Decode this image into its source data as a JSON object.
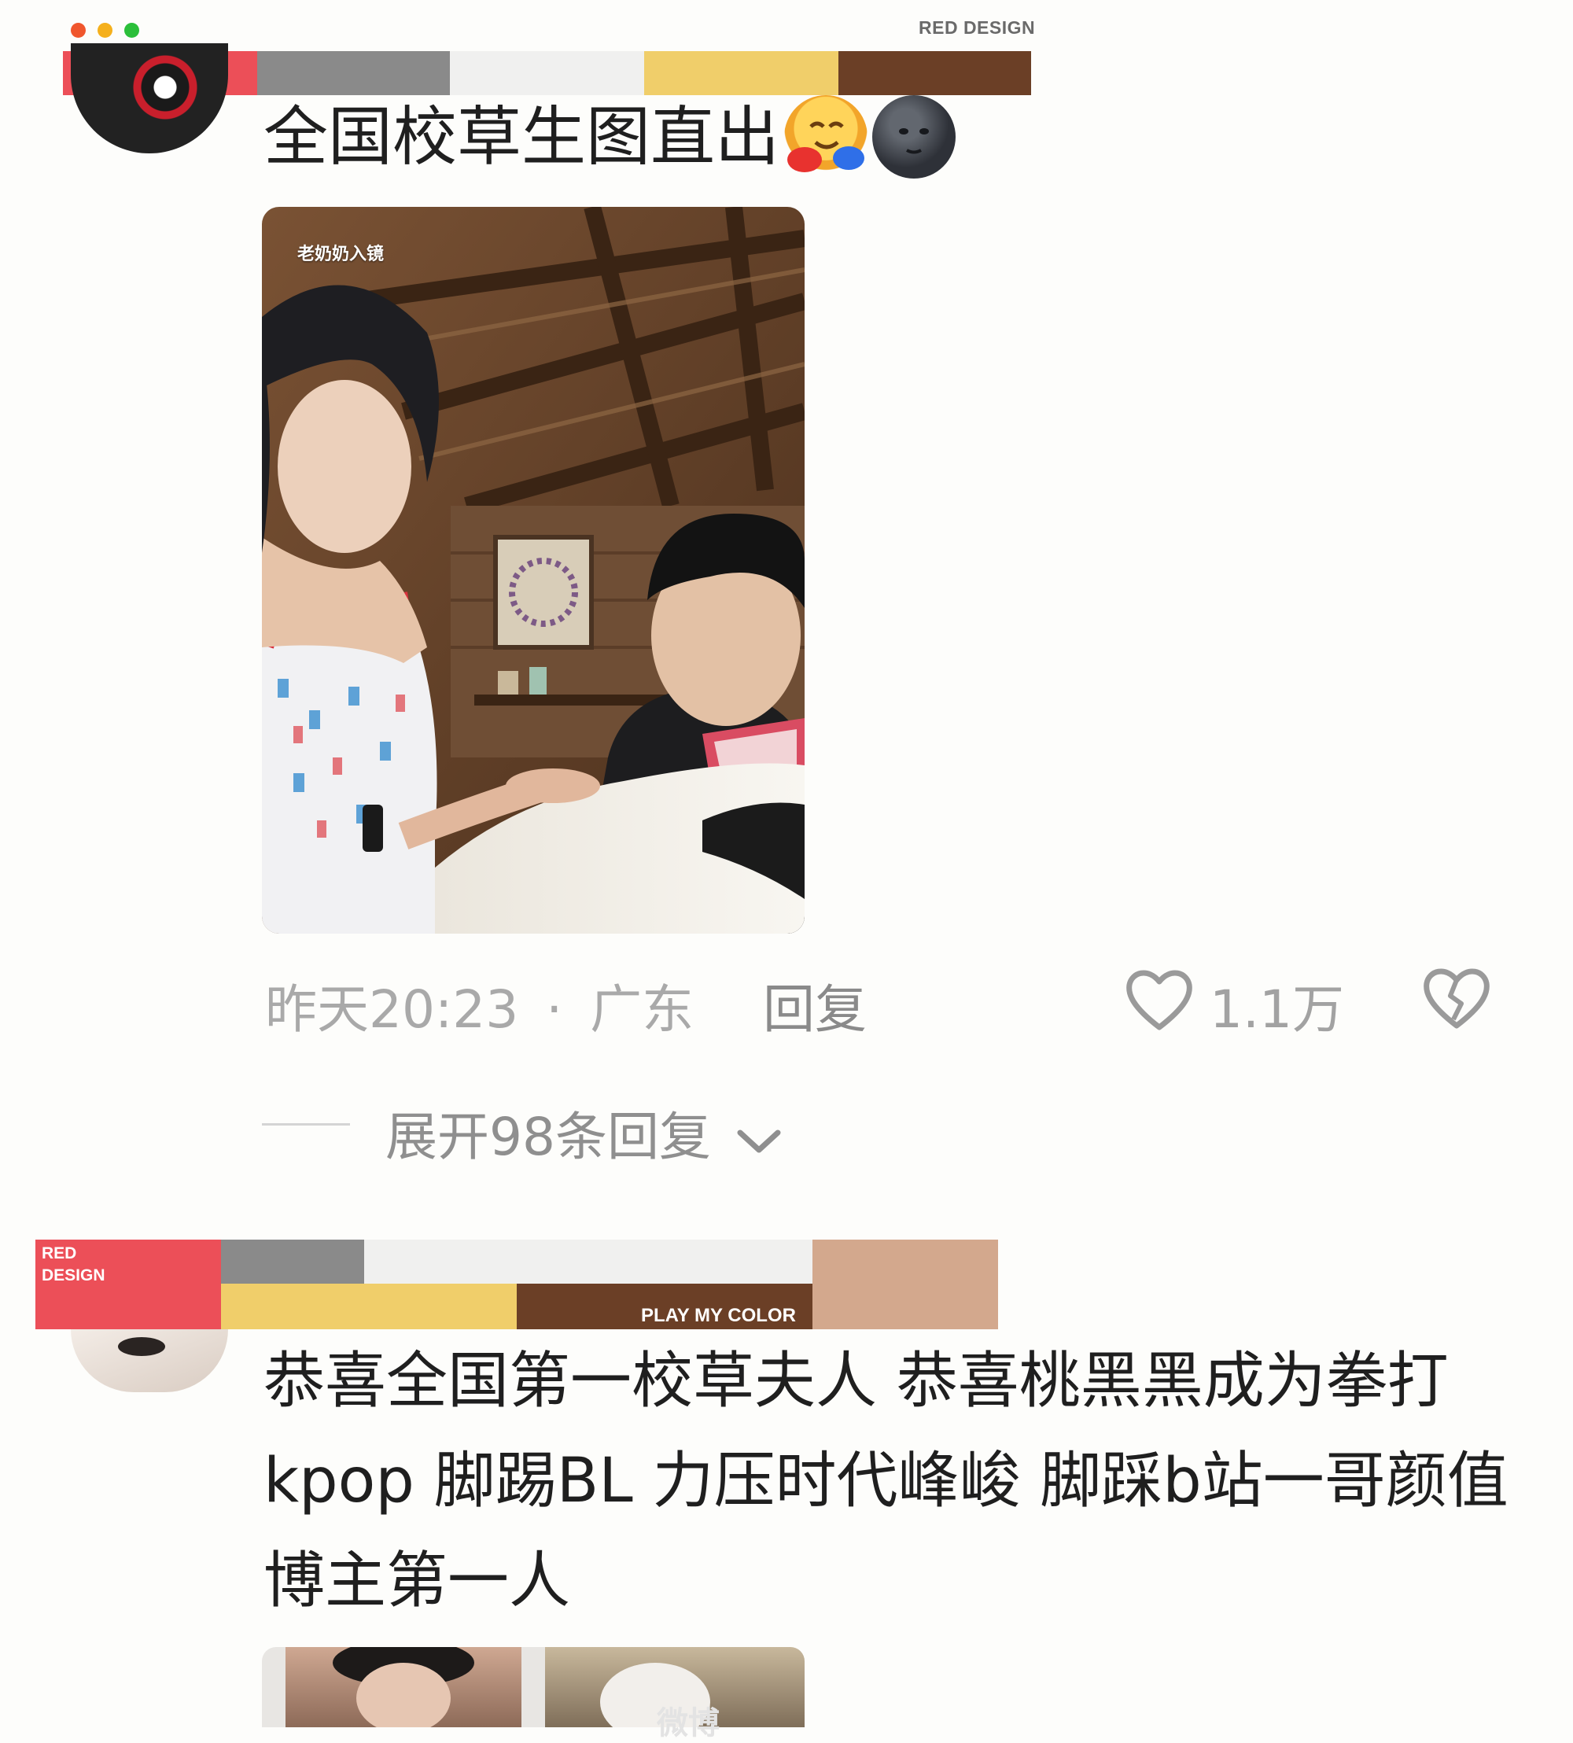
{
  "brand": {
    "top_label": "RED DESIGN",
    "badge_label": "RED\nDESIGN",
    "tagline": "PLAY MY COLOR",
    "colors_top": [
      "#ec4f58",
      "#8a8a8a",
      "#f0f0ef",
      "#f0ce6a",
      "#6b3f26"
    ],
    "colors_bottom": [
      "#ec4f58",
      "#8a8a8a",
      "#f0f0ef",
      "#f0ce6a",
      "#6b3f26",
      "#d3a88d"
    ]
  },
  "window": {
    "dots": [
      "#f0562d",
      "#f5b01c",
      "#2bbf3a"
    ]
  },
  "comment1": {
    "text": "全国校草生图直出",
    "emojis": [
      "hugging-face-emoji",
      "new-moon-face-emoji"
    ],
    "photo_caption": "老奶奶入镜",
    "time": "昨天20:23",
    "location": "广东",
    "separator": "·",
    "reply_label": "回复",
    "like_count": "1.1万",
    "like_icon": "heart-outline-icon",
    "dislike_icon": "broken-heart-icon",
    "expand_label": "展开98条回复"
  },
  "comment2": {
    "text": "恭喜全国第一校草夫人 恭喜桃黑黑成为拳打kpop 脚踢BL 力压时代峰峻 脚踩b站一哥颜值博主第一人"
  },
  "watermark": "微博"
}
